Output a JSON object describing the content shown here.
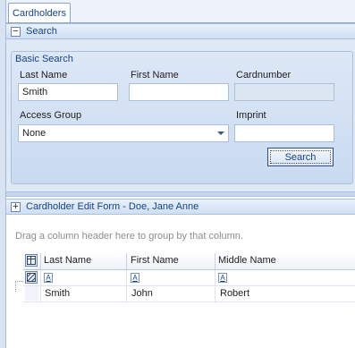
{
  "tabs": [
    {
      "label": "Cardholders"
    }
  ],
  "search_section": {
    "toggle": "−",
    "title": "Search"
  },
  "basic_search": {
    "title": "Basic Search",
    "last_name_label": "Last Name",
    "last_name_value": "Smith",
    "first_name_label": "First Name",
    "first_name_value": "",
    "cardnumber_label": "Cardnumber",
    "cardnumber_value": "",
    "access_group_label": "Access Group",
    "access_group_value": "None",
    "imprint_label": "Imprint",
    "imprint_value": "",
    "search_button": "Search"
  },
  "edit_section": {
    "toggle": "+",
    "title": "Cardholder Edit Form - Doe, Jane Anne"
  },
  "grid": {
    "group_by_hint": "Drag a column header here to group by that column.",
    "columns": [
      "Last Name",
      "First Name",
      "Middle Name"
    ],
    "filter_glyph": "A",
    "rows": [
      {
        "last": "Smith",
        "first": "John",
        "middle": "Robert"
      }
    ]
  }
}
